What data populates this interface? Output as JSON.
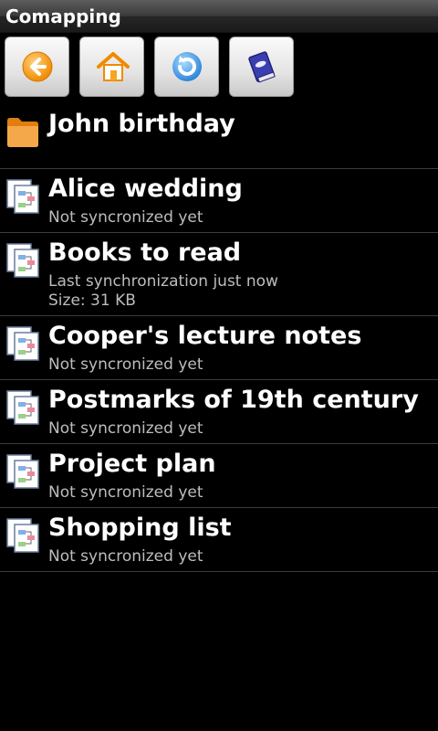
{
  "app": {
    "title": "Comapping"
  },
  "toolbar": {
    "buttons": [
      {
        "icon": "back-arrow-icon"
      },
      {
        "icon": "home-icon"
      },
      {
        "icon": "refresh-icon"
      },
      {
        "icon": "book-icon"
      }
    ]
  },
  "list": {
    "items": [
      {
        "type": "folder",
        "icon": "folder-icon",
        "name": "John birthday"
      },
      {
        "type": "map",
        "icon": "map-document-icon",
        "name": "Alice wedding",
        "status": "Not syncronized yet"
      },
      {
        "type": "map",
        "icon": "map-document-icon",
        "name": "Books to read",
        "status": "Last synchronization just now",
        "size": "Size: 31 KB"
      },
      {
        "type": "map",
        "icon": "map-document-icon",
        "name": "Cooper's lecture notes",
        "status": "Not syncronized yet"
      },
      {
        "type": "map",
        "icon": "map-document-icon",
        "name": "Postmarks of 19th century",
        "status": "Not syncronized yet"
      },
      {
        "type": "map",
        "icon": "map-document-icon",
        "name": "Project plan",
        "status": "Not syncronized yet"
      },
      {
        "type": "map",
        "icon": "map-document-icon",
        "name": "Shopping list",
        "status": "Not syncronized yet"
      }
    ]
  },
  "colors": {
    "background": "#000000",
    "text_primary": "#ffffff",
    "text_secondary": "#bdbdbd",
    "divider": "#3c3c3c",
    "accent_orange": "#f5a623",
    "accent_blue": "#3b8fe0"
  }
}
